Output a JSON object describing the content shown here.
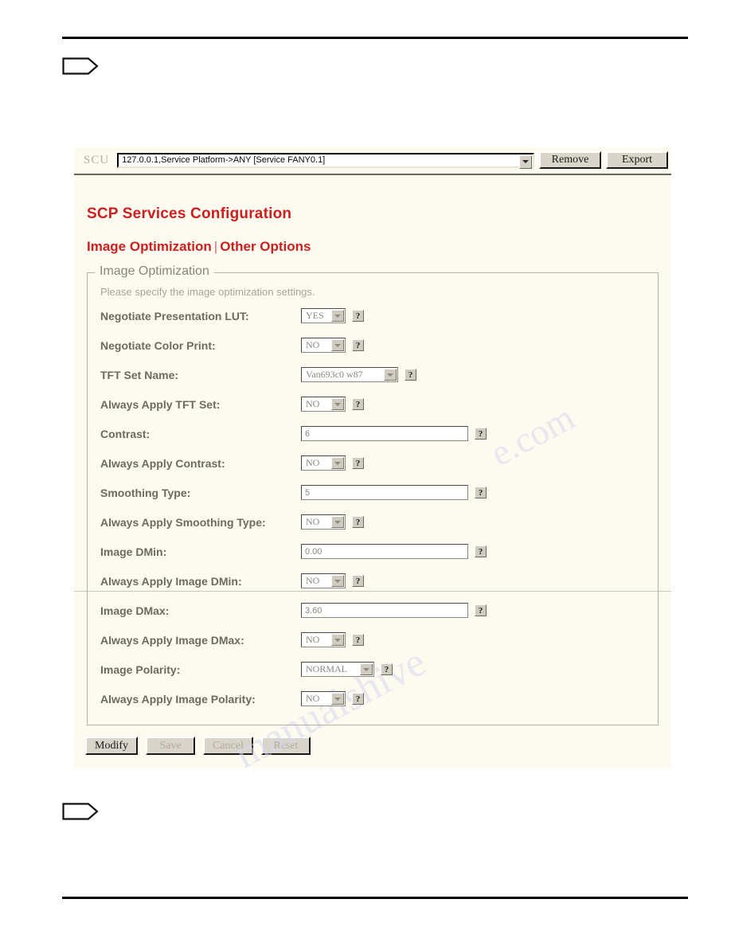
{
  "document": {
    "watermark_1": "e.com",
    "watermark_2": "manualshive"
  },
  "markers": {
    "top_name": "section-arrow-marker-top",
    "bottom_name": "section-arrow-marker-bottom"
  },
  "toolbar": {
    "scu_label": "SCU",
    "connection_value": "127.0.0.1,Service Platform->ANY [Service FANY0.1]",
    "remove_label": "Remove",
    "export_label": "Export"
  },
  "page": {
    "title": "SCP Services Configuration",
    "nav": {
      "image_optimization": "Image Optimization",
      "separator": "|",
      "other_options": "Other Options"
    },
    "fieldset": {
      "legend": "Image Optimization",
      "description": "Please specify the image optimization settings."
    }
  },
  "fields": [
    {
      "label": "Negotiate Presentation LUT:",
      "type": "select",
      "value": "YES",
      "width": "w-yesno",
      "help": "?"
    },
    {
      "label": "Negotiate Color Print:",
      "type": "select",
      "value": "NO",
      "width": "w-yesno",
      "help": "?"
    },
    {
      "label": "TFT Set Name:",
      "type": "select",
      "value": "Van693c0 w87",
      "width": "w-tft",
      "help": "?"
    },
    {
      "label": "Always Apply TFT Set:",
      "type": "select",
      "value": "NO",
      "width": "w-yesno",
      "help": "?"
    },
    {
      "label": "Contrast:",
      "type": "text",
      "value": "6",
      "width": "w-long",
      "help": "?"
    },
    {
      "label": "Always Apply Contrast:",
      "type": "select",
      "value": "NO",
      "width": "w-yesno",
      "help": "?"
    },
    {
      "label": "Smoothing Type:",
      "type": "text",
      "value": "5",
      "width": "w-long",
      "help": "?"
    },
    {
      "label": "Always Apply Smoothing Type:",
      "type": "select",
      "value": "NO",
      "width": "w-yesno",
      "help": "?"
    },
    {
      "label": "Image DMin:",
      "type": "text",
      "value": "0.00",
      "width": "w-long",
      "help": "?"
    },
    {
      "label": "Always Apply Image DMin:",
      "type": "select",
      "value": "NO",
      "width": "w-yesno",
      "help": "?"
    },
    {
      "label": "Image DMax:",
      "type": "text",
      "value": "3.60",
      "width": "w-long",
      "help": "?"
    },
    {
      "label": "Always Apply Image DMax:",
      "type": "select",
      "value": "NO",
      "width": "w-yesno",
      "help": "?"
    },
    {
      "label": "Image Polarity:",
      "type": "select",
      "value": "NORMAL",
      "width": "w-normal",
      "help": "?"
    },
    {
      "label": "Always Apply Image Polarity:",
      "type": "select",
      "value": "NO",
      "width": "w-yesno",
      "help": "?"
    }
  ],
  "buttons": [
    {
      "label": "Modify",
      "disabled": false
    },
    {
      "label": "Save",
      "disabled": true
    },
    {
      "label": "Cancel",
      "disabled": true
    },
    {
      "label": "Reset",
      "disabled": true
    }
  ],
  "colors": {
    "accent_red": "#cc2020",
    "panel_bg": "#fdfaf0",
    "control_face": "#d9d5cb",
    "label_text": "#6d6a62"
  }
}
